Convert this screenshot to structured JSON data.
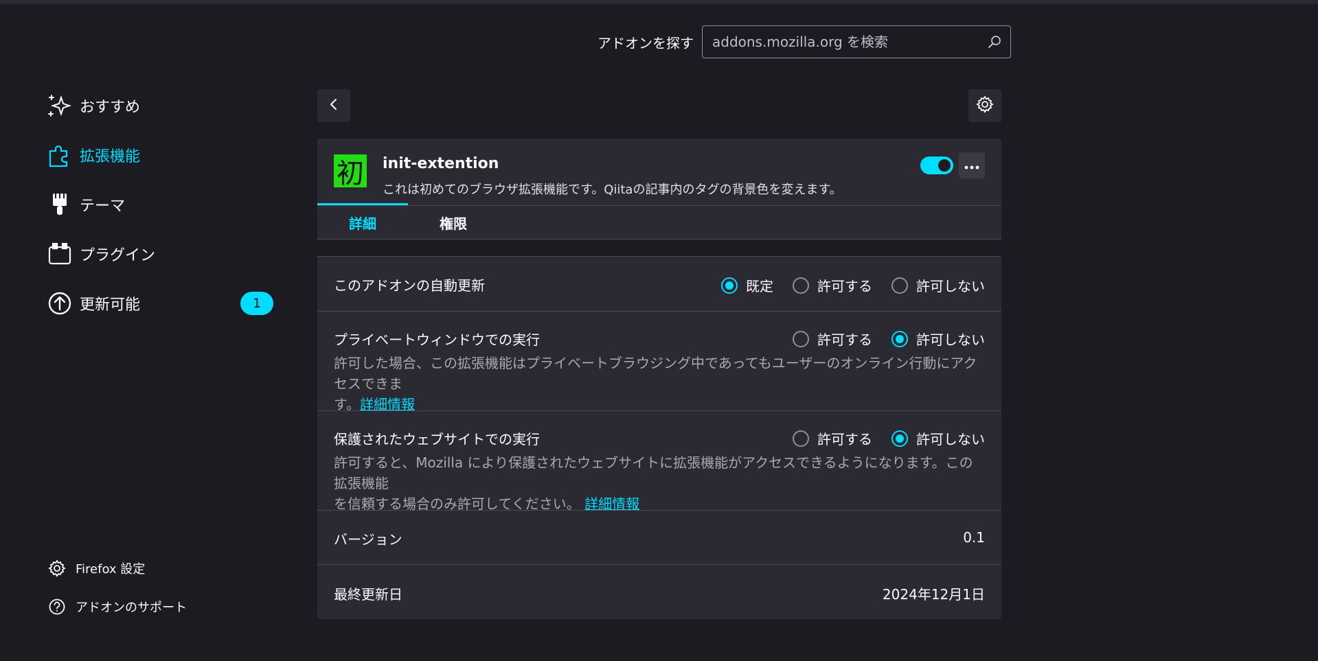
{
  "search": {
    "label": "アドオンを探す",
    "placeholder": "addons.mozilla.org を検索"
  },
  "sidebar": {
    "items": [
      {
        "label": "おすすめ",
        "icon": "sparkles-icon"
      },
      {
        "label": "拡張機能",
        "icon": "puzzle-icon",
        "active": true
      },
      {
        "label": "テーマ",
        "icon": "brush-icon"
      },
      {
        "label": "プラグイン",
        "icon": "plugin-icon"
      },
      {
        "label": "更新可能",
        "icon": "update-arrow-icon",
        "badge": "1"
      }
    ],
    "footer": [
      {
        "label": "Firefox 設定",
        "icon": "gear-icon"
      },
      {
        "label": "アドオンのサポート",
        "icon": "help-icon"
      }
    ]
  },
  "addon": {
    "icon_char": "初",
    "name": "init-extention",
    "description": "これは初めてのブラウザ拡張機能です。Qiitaの記事内のタグの背景色を変えます。",
    "enabled": true
  },
  "tabs": [
    {
      "label": "詳細",
      "active": true
    },
    {
      "label": "権限"
    }
  ],
  "settings": {
    "auto_update": {
      "title": "このアドオンの自動更新",
      "options": [
        "既定",
        "許可する",
        "許可しない"
      ],
      "selected": "既定"
    },
    "private": {
      "title": "プライベートウィンドウでの実行",
      "options": [
        "許可する",
        "許可しない"
      ],
      "selected": "許可しない",
      "help_line1": "許可した場合、この拡張機能はプライベートブラウジング中であってもユーザーのオンライン行動にアクセスできま",
      "help_line2": "す。",
      "link": "詳細情報"
    },
    "protected": {
      "title": "保護されたウェブサイトでの実行",
      "options": [
        "許可する",
        "許可しない"
      ],
      "selected": "許可しない",
      "help_line1": "許可すると、Mozilla により保護されたウェブサイトに拡張機能がアクセスできるようになります。この拡張機能",
      "help_line2": "を信頼する場合のみ許可してください。",
      "link": "詳細情報"
    },
    "version": {
      "label": "バージョン",
      "value": "0.1"
    },
    "last_updated": {
      "label": "最終更新日",
      "value": "2024年12月1日"
    }
  },
  "colors": {
    "accent": "#00ddff",
    "background": "#1c1b22",
    "card": "#2b2a33",
    "addon_icon_bg": "#22dd11"
  }
}
